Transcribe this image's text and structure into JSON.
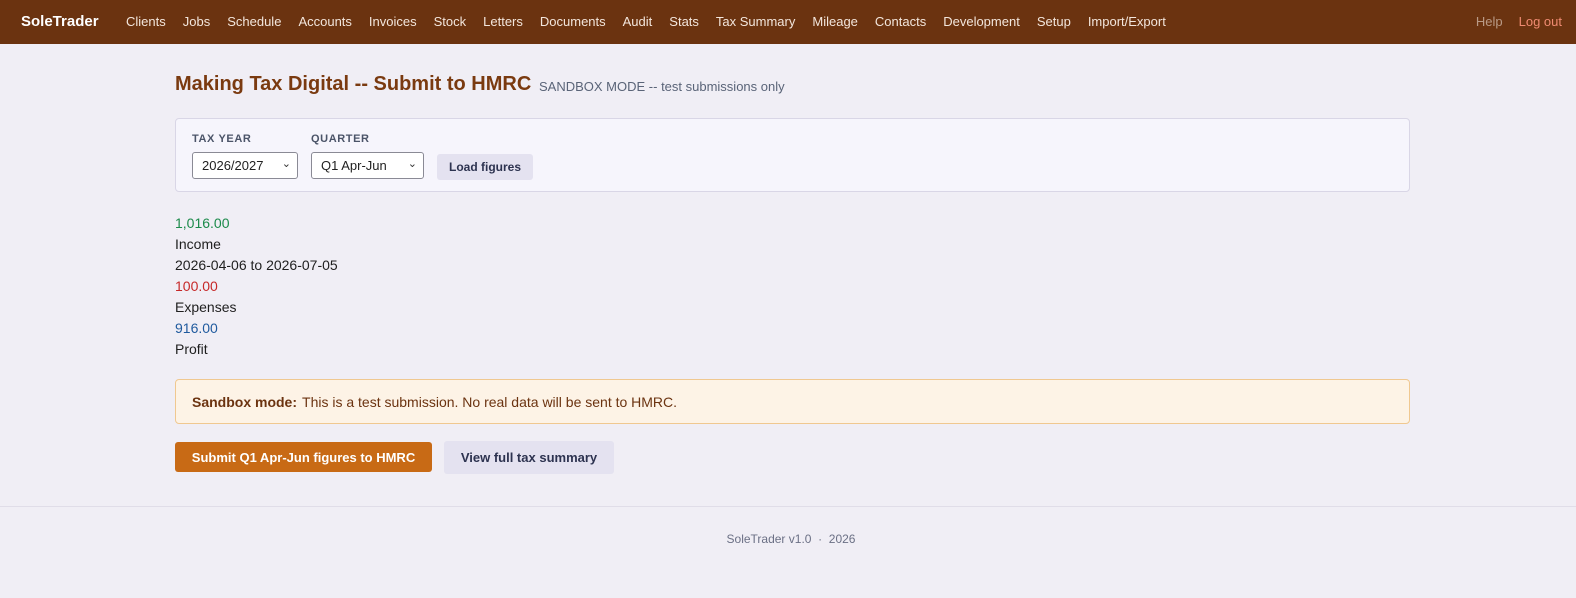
{
  "nav": {
    "brand": "SoleTrader",
    "links": [
      "Clients",
      "Jobs",
      "Schedule",
      "Accounts",
      "Invoices",
      "Stock",
      "Letters",
      "Documents",
      "Audit",
      "Stats",
      "Tax Summary",
      "Mileage",
      "Contacts",
      "Development",
      "Setup",
      "Import/Export"
    ],
    "help": "Help",
    "logout": "Log out"
  },
  "header": {
    "title": "Making Tax Digital -- Submit to HMRC",
    "subtitle": "SANDBOX MODE -- test submissions only"
  },
  "filters": {
    "tax_year_label": "TAX YEAR",
    "tax_year_value": "2026/2027",
    "quarter_label": "QUARTER",
    "quarter_value": "Q1 Apr-Jun",
    "load_label": "Load figures"
  },
  "figures": {
    "income_value": "1,016.00",
    "income_label": "Income",
    "period": "2026-04-06 to 2026-07-05",
    "expenses_value": "100.00",
    "expenses_label": "Expenses",
    "profit_value": "916.00",
    "profit_label": "Profit"
  },
  "alert": {
    "strong": "Sandbox mode:",
    "text": "This is a test submission. No real data will be sent to HMRC."
  },
  "actions": {
    "submit_label": "Submit Q1 Apr-Jun figures to HMRC",
    "view_label": "View full tax summary"
  },
  "footer": {
    "text": "SoleTrader v1.0  ·  2026"
  },
  "colors": {
    "nav_bg": "#6b3310",
    "title": "#7a3a10",
    "submit": "#c86a15",
    "income": "#1b8a4a",
    "expense": "#c62828",
    "profit": "#1f5a9e"
  }
}
